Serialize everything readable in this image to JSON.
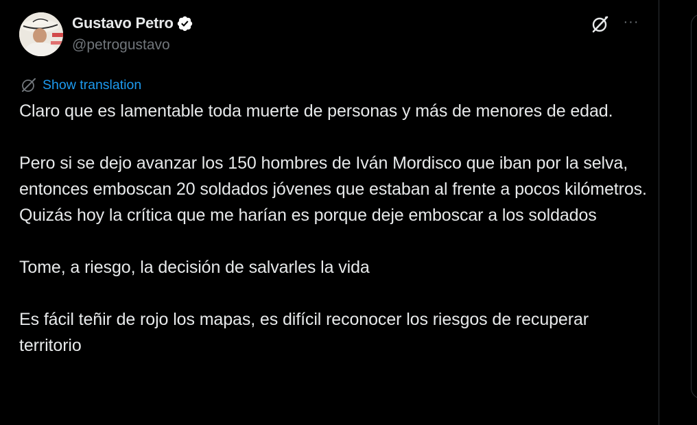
{
  "author": {
    "display_name": "Gustavo Petro",
    "handle": "@petrogustavo",
    "verified_icon": "verified-badge-icon"
  },
  "actions": {
    "grok_icon": "grok-icon",
    "more_icon": "more-horizontal-icon",
    "more_label": "···"
  },
  "translation": {
    "icon": "translate-icon",
    "label": "Show translation"
  },
  "tweet": {
    "paragraphs": [
      "Claro que es lamentable toda muerte de personas y más de menores de edad.",
      "Pero si se dejo avanzar los 150 hombres de Iván Mordisco que iban por la selva, entonces emboscan 20 soldados jóvenes que estaban al frente a pocos kilómetros. Quizás hoy la crítica que me harían es porque deje emboscar a los soldados",
      "Tome, a riesgo, la decisión de salvarles la vida",
      "Es fácil teñir de rojo los mapas, es difícil reconocer los riesgos de recuperar territorio"
    ]
  },
  "colors": {
    "background": "#000000",
    "text_primary": "#e7e9ea",
    "text_secondary": "#71767b",
    "accent": "#1d9bf0",
    "divider": "#2f3336"
  }
}
